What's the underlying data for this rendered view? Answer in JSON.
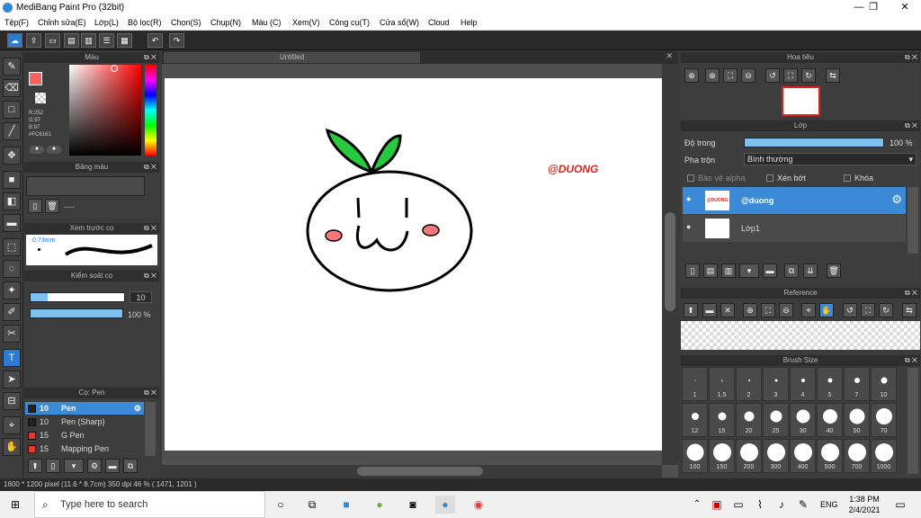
{
  "window": {
    "title": "MediBang Paint Pro (32bit)",
    "min": "—",
    "max": "❐",
    "close": "✕"
  },
  "menu": [
    "Tệp(F)",
    "Chỉnh sửa(E)",
    "Lớp(L)",
    "Bộ lọc(R)",
    "Chọn(S)",
    "Chụp(N)",
    "Màu (C)",
    "Xem(V)",
    "Công cụ(T)",
    "Cửa sổ(W)",
    "Cloud",
    "Help"
  ],
  "color_panel": {
    "title": "Màu",
    "r": "R:252",
    "g": "G:97",
    "b": "B:97",
    "hex": "#FC6161",
    "accent": "#FC6161"
  },
  "palette_panel": {
    "title": "Bảng màu",
    "text": "----"
  },
  "brush_preview": {
    "title": "Xem trước cọ",
    "size": "0.73mm"
  },
  "brush_control": {
    "title": "Kiểm soát cọ",
    "size_value": "10",
    "opacity_value": "100 %",
    "opacity_fraction": 1.0
  },
  "pen_panel": {
    "title": "Cọ: Pen",
    "items": [
      {
        "size": "10",
        "name": "Pen",
        "color": "#222222",
        "selected": true
      },
      {
        "size": "10",
        "name": "Pen (Sharp)",
        "color": "#222222",
        "selected": false
      },
      {
        "size": "15",
        "name": "G Pen",
        "color": "#e53935",
        "selected": false
      },
      {
        "size": "15",
        "name": "Mapping Pen",
        "color": "#e53935",
        "selected": false
      }
    ]
  },
  "canvas": {
    "tab": "Untitled",
    "watermark": "@DUONG"
  },
  "navigator": {
    "title": "Hoa tiêu"
  },
  "layer_panel": {
    "title": "Lớp",
    "opacity_label": "Độ trong",
    "opacity_value": "100 %",
    "opacity_fraction": 1.0,
    "blend_label": "Pha trộn",
    "blend_value": "Bình thường",
    "protect_alpha": "Bảo vệ alpha",
    "clipping": "Xén bớt",
    "lock": "Khóa",
    "layers": [
      {
        "name": "@duong",
        "thumb": "@DUONG",
        "selected": true
      },
      {
        "name": "Lớp1",
        "selected": false
      }
    ]
  },
  "reference": {
    "title": "Reference"
  },
  "brush_size": {
    "title": "Brush Size",
    "sizes": [
      "1",
      "1.5",
      "2",
      "3",
      "4",
      "5",
      "7",
      "10",
      "12",
      "15",
      "20",
      "25",
      "30",
      "40",
      "50",
      "70",
      "100",
      "150",
      "200",
      "300",
      "400",
      "500",
      "700",
      "1000"
    ]
  },
  "status": {
    "text": "1600 * 1200 pixel  (11.6 * 8.7cm)  350 dpi  46 %  ( 1471, 1201 )"
  },
  "taskbar": {
    "search_placeholder": "Type here to search",
    "time": "1:38 PM",
    "date": "2/4/2021",
    "lang": "ENG"
  }
}
